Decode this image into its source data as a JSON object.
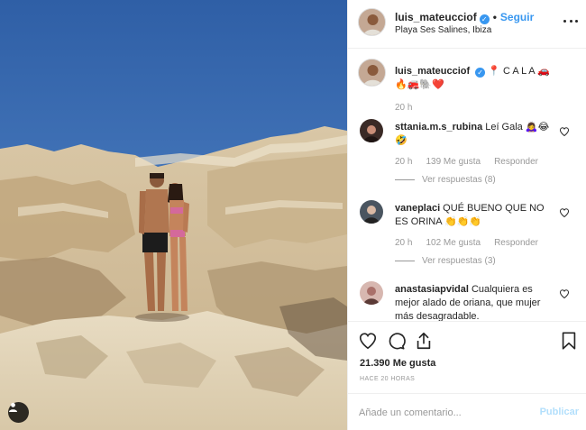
{
  "header": {
    "username": "luis_mateucciof",
    "separator": "•",
    "follow_label": "Seguir",
    "location": "Playa Ses Salines, Ibiza"
  },
  "caption": {
    "username": "luis_mateucciof",
    "text_line1": "📍 C A L A 🚗",
    "text_line2": "🔥🚒🐘❤️",
    "time": "20 h"
  },
  "comments": [
    {
      "username": "sttania.m.s_rubina",
      "text": "Leí Gala 🙇‍♀️😂🤣",
      "time": "20 h",
      "likes": "139 Me gusta",
      "reply_label": "Responder",
      "replies": "Ver respuestas (8)"
    },
    {
      "username": "vaneplaci",
      "text": "QUÉ BUENO QUE NO ES ORINA 👏👏👏",
      "time": "20 h",
      "likes": "102 Me gusta",
      "reply_label": "Responder",
      "replies": "Ver respuestas (3)"
    },
    {
      "username": "anastasiapvidal",
      "text": "Cualquiera es mejor alado de oriana, que mujer más desagradable."
    }
  ],
  "actions": {
    "icons": [
      "heart-icon",
      "comment-icon",
      "share-icon",
      "bookmark-icon"
    ]
  },
  "likes_count": "21.390 Me gusta",
  "posted_ago": "HACE 20 HORAS",
  "comment_box": {
    "placeholder": "Añade un comentario...",
    "publish_label": "Publicar"
  },
  "colors": {
    "accent": "#3897f0",
    "publish_disabled": "#b2dffc",
    "muted_text": "#999999",
    "heart_red": "#ed4956"
  }
}
